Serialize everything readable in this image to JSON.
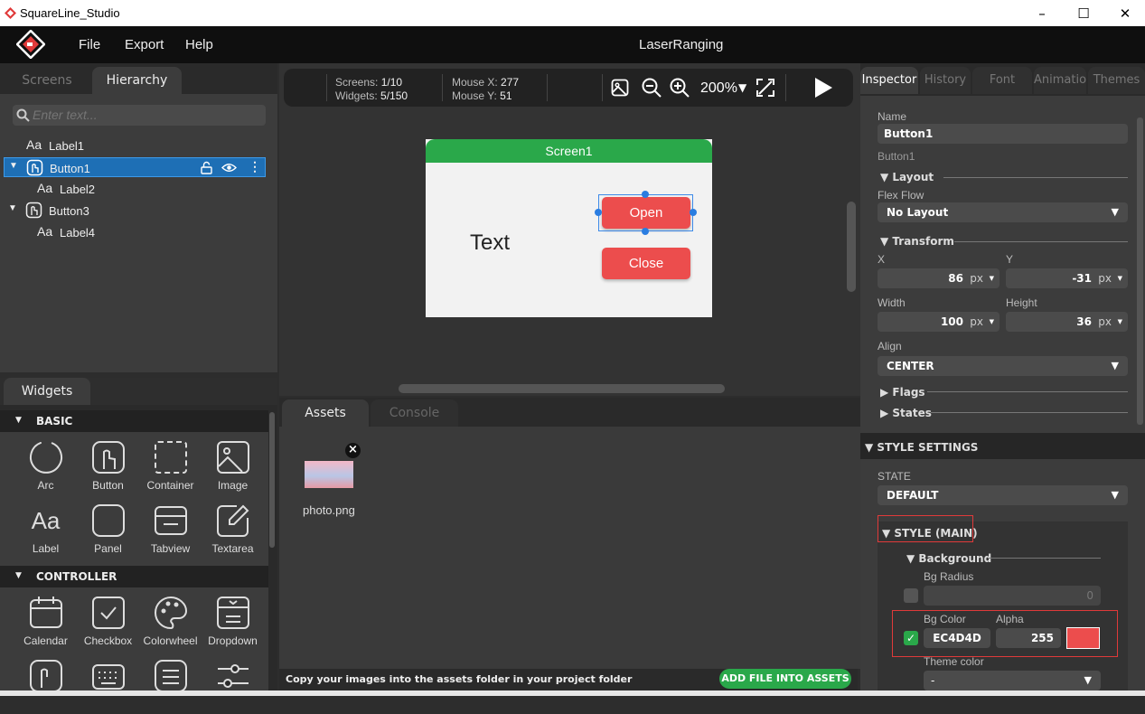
{
  "window": {
    "title": "SquareLine_Studio",
    "minimize": "–",
    "maximize": "☐",
    "close": "✕"
  },
  "menu": {
    "file": "File",
    "export": "Export",
    "help": "Help"
  },
  "project_title": "LaserRanging",
  "hierarchy": {
    "tabs": [
      "Screens",
      "Hierarchy"
    ],
    "search_placeholder": "Enter text...",
    "items": [
      {
        "label": "Label1",
        "icon": "label-icon"
      },
      {
        "label": "Button1",
        "icon": "button-icon",
        "selected": true
      },
      {
        "label": "Label2",
        "icon": "label-icon"
      },
      {
        "label": "Button3",
        "icon": "button-icon"
      },
      {
        "label": "Label4",
        "icon": "label-icon"
      }
    ],
    "label_glyph": "Aa"
  },
  "widgets": {
    "tab": "Widgets",
    "categories": [
      {
        "name": "BASIC",
        "items": [
          "Arc",
          "Button",
          "Container",
          "Image",
          "Label",
          "Panel",
          "Tabview",
          "Textarea"
        ]
      },
      {
        "name": "CONTROLLER",
        "items": [
          "Calendar",
          "Checkbox",
          "Colorwheel",
          "Dropdown"
        ]
      }
    ]
  },
  "toolbar": {
    "screens_label": "Screens:",
    "screens_value": "1/10",
    "widgets_label": "Widgets:",
    "widgets_value": "5/150",
    "mousex_label": "Mouse X:",
    "mousex_value": "277",
    "mousey_label": "Mouse Y:",
    "mousey_value": "51",
    "zoom": "200%",
    "zoom_caret": "▼"
  },
  "screen": {
    "title": "Screen1",
    "text_label": "Text",
    "open_button": "Open",
    "close_button": "Close",
    "header_color": "#2aa84a"
  },
  "assets": {
    "tabs": [
      "Assets",
      "Console"
    ],
    "file": "photo.png",
    "remove": "×",
    "hint": "Copy your images into the assets folder in your project folder",
    "add_button": "ADD FILE INTO ASSETS"
  },
  "inspector": {
    "tabs": [
      "Inspector",
      "History",
      "Font",
      "Animatio",
      "Themes"
    ],
    "name_label": "Name",
    "name_value": "Button1",
    "type_label": "Button1",
    "layout_section": "▼ Layout",
    "flex_label": "Flex Flow",
    "flex_value": "No Layout",
    "transform_section": "▼ Transform",
    "x_label": "X",
    "x_value": "86",
    "y_label": "Y",
    "y_value": "-31",
    "px": "px",
    "width_label": "Width",
    "width_value": "100",
    "height_label": "Height",
    "height_value": "36",
    "align_label": "Align",
    "align_value": "CENTER",
    "flags_section": "▶ Flags",
    "states_section": "▶ States",
    "style_settings": "▼ STYLE SETTINGS",
    "state_label": "STATE",
    "state_value": "DEFAULT",
    "style_main": "▼ STYLE (MAIN)",
    "background_section": "▼ Background",
    "bg_radius_label": "Bg Radius",
    "bg_radius_value": "0",
    "bg_color_label": "Bg Color",
    "alpha_label": "Alpha",
    "bg_color_value": "EC4D4D",
    "alpha_value": "255",
    "theme_color_label": "Theme color",
    "theme_color_value": "-",
    "swatch": "#EC4D4D"
  }
}
